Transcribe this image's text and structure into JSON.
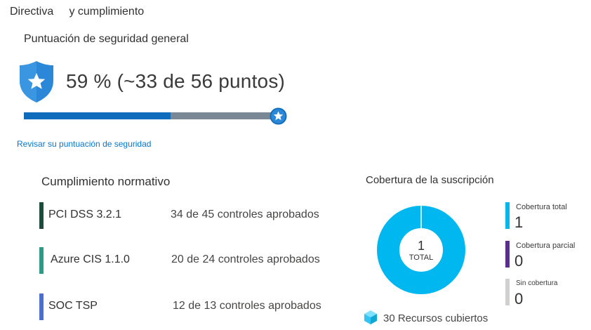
{
  "header": {
    "title": "Directiva     y cumplimiento"
  },
  "secure_score": {
    "heading": "Puntuación de seguridad general",
    "value_text": "59 % (~33 de 56 puntos)",
    "percent": 59,
    "review_link": "Revisar su puntuación de seguridad",
    "colors": {
      "fill": "#0f6cbd",
      "track": "#7a8896",
      "shield": "#2b88d8"
    }
  },
  "regulatory_compliance": {
    "heading": "Cumplimiento normativo",
    "standards": [
      {
        "name": "PCI DSS 3.2.1",
        "controls": "34  de 45 controles aprobados",
        "color": "#1e4b3a"
      },
      {
        "name": "Azure CIS 1.1.0",
        "controls": "20 de 24 controles aprobados",
        "color": "#2d9c86"
      },
      {
        "name": "SOC TSP",
        "controls": "12 de 13 controles aprobados",
        "color": "#4a6ed1"
      }
    ]
  },
  "subscription_coverage": {
    "heading": "Cobertura de la suscripción",
    "total_number": "1",
    "total_label": "TOTAL",
    "legend": [
      {
        "label": "Cobertura total",
        "value": "1",
        "color": "#00b7f0"
      },
      {
        "label": "Cobertura parcial",
        "value": "0",
        "color": "#5c2d91"
      },
      {
        "label": "Sin cobertura",
        "value": "0",
        "color": "#d2d0ce"
      }
    ],
    "resources_text": "30 Recursos cubiertos",
    "icon": "cube-icon"
  }
}
